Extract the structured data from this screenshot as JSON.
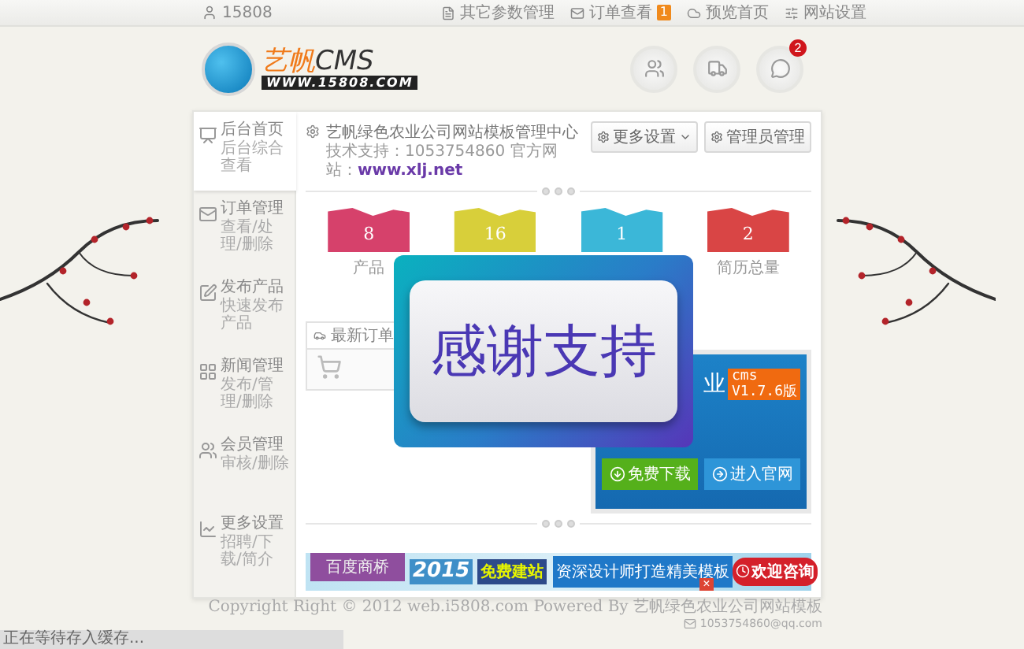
{
  "top_bar": {
    "user": "15808",
    "links": [
      {
        "label": "其它参数管理"
      },
      {
        "label": "订单查看",
        "badge": "1"
      },
      {
        "label": "预览首页"
      },
      {
        "label": "网站设置"
      }
    ]
  },
  "logo": {
    "name": "艺帆",
    "suffix": "CMS",
    "url": "WWW.15808.COM"
  },
  "quick_buttons": [
    {
      "kind": "members"
    },
    {
      "kind": "delivery"
    },
    {
      "kind": "messages",
      "badge": "2"
    }
  ],
  "sidebar": {
    "items": [
      {
        "title": "后台首页",
        "subtitle": "后台综合查看",
        "selected": true
      },
      {
        "title": "订单管理",
        "subtitle": "查看/处理/删除",
        "selected": false
      },
      {
        "title": "发布产品",
        "subtitle": "快速发布产品",
        "selected": false
      },
      {
        "title": "新闻管理",
        "subtitle": "发布/管理/删除",
        "selected": false
      },
      {
        "title": "会员管理",
        "subtitle": "审核/删除",
        "selected": false
      },
      {
        "title": "更多设置",
        "subtitle": "招聘/下载/简介",
        "selected": false
      }
    ]
  },
  "content": {
    "title": "艺帆绿色农业公司网站模板管理中心",
    "support": "技术支持：1053754860 官方网站：",
    "support_link": "www.xlj.net",
    "buttons": [
      "更多设置",
      "管理员管理"
    ]
  },
  "stats": [
    {
      "value": "8",
      "label": "产品",
      "color": "#d6416b"
    },
    {
      "value": "16",
      "color": "#d8cf3a"
    },
    {
      "value": "1",
      "color": "#3bb7d8"
    },
    {
      "value": "2",
      "label": "简历总量",
      "color": "#d94545"
    }
  ],
  "orders_panel": {
    "title": "最新订单"
  },
  "promo": {
    "partial_title": "业",
    "badge_name": "cms",
    "badge_version": "V1.7.6版",
    "buttons": [
      "免费下载",
      "进入官网"
    ]
  },
  "banner": {
    "tab": "百度商桥",
    "year": "2015",
    "slogan": "免费建站",
    "headline": "资深设计师打造精美模板",
    "close": "×",
    "cta": "欢迎咨询"
  },
  "popup": {
    "text": "感谢支持"
  },
  "footer": {
    "copyright": "Copyright Right © 2012 web.i5808.com Powered By 艺帆绿色农业公司网站模板",
    "email": "1053754860@qq.com"
  },
  "status_bar": {
    "text": "正在等待存入缓存..."
  }
}
